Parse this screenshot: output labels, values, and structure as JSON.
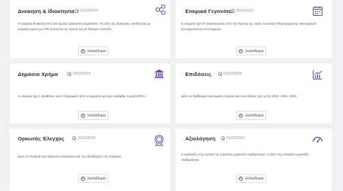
{
  "cards": [
    {
      "title": "Διοίκηση & Ιδιοκτησία",
      "date": "21/03/2024",
      "description_lines": [
        "Η εταιρεία διοικείται από ένα 5μελές Διοικητικό Συμβούλιο. Το μέλη της διοίκησης συνδέονται με",
        "εταιρική σχέση με 278 πρόσωπα σε πρώτο και σε δεύτερο επίπεδο."
      ],
      "button_label": "Ξεκλείδωμα",
      "icon": "network-share-icon"
    },
    {
      "title": "Εταιρικά Γεγονότα",
      "date": "30/11/2023",
      "description_lines": [
        "Η εταιρεία έχει 67 ανακοινώσεις από την ίδρυση της. Δείτε τα Δελτία Πληροφόρησης Οικονομικών",
        "και Δημοσιεύσεων Εταιρειών."
      ],
      "button_label": "Ξεκλείδωμα",
      "icon": "calendar-icon"
    },
    {
      "title": "Δημόσιο Χρήμα",
      "date": "29/03/2024",
      "description_lines": [
        "Η εταιρεία έχει 1 αναθέσεις και 0 πληρωμές από το Δημόσιο και έχει αναλάβει 3 έργα ΕΣΠΑ."
      ],
      "button_label": "Ξεκλείδωμα",
      "icon": "bank-icon"
    },
    {
      "title": "Επιδόσεις",
      "date": "01/03/2024",
      "description_lines": [
        "Δείτε τα διαθέσιμα οικονομικά στοιχεία και τους δείκτες για τα έτη 2022, 2021, 2020."
      ],
      "button_label": "Ξεκλείδωμα",
      "icon": "chart-icon"
    },
    {
      "title": "Ορκωτός Έλεγχος",
      "date": "28/03/2024",
      "description_lines": [
        "Δείτε τα στοιχεία των Ορκωτών Ελεγκτών και την αξιολόγηση της εταιρείας."
      ],
      "button_label": "Ξεκλείδωμα",
      "icon": "seal-badge-icon"
    },
    {
      "title": "Αξιολόγηση",
      "date": "01/03/2024",
      "description_lines": [
        "Η κατάταξη στην αγορά της εταιρείας εμφανίζει σταθερότητα. Η τάση της εταιρείας εμφανίζει",
        "σταθερότητα."
      ],
      "button_label": "Ξεκλείδωμα",
      "icon": "gauge-icon"
    }
  ],
  "colors": {
    "accent": "#6a3fb3",
    "background": "#f1f1f3",
    "card": "#ffffff"
  }
}
